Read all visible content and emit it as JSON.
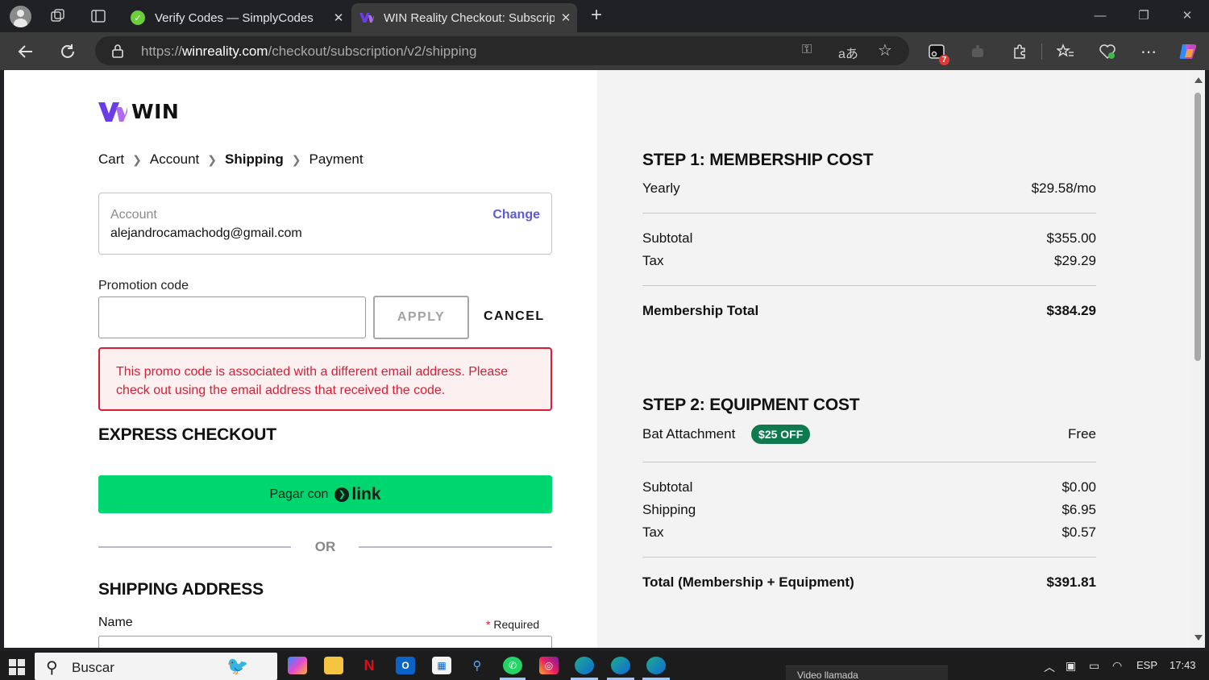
{
  "browser": {
    "tabs": [
      {
        "title": "Verify Codes — SimplyCodes",
        "favicon": "simplycodes-check-icon",
        "active": false
      },
      {
        "title": "WIN Reality Checkout: Subscriptio",
        "favicon": "win-logo-icon",
        "active": true
      }
    ],
    "url": {
      "scheme": "https://",
      "domain": "winreality.com",
      "path": "/checkout/subscription/v2/shipping"
    },
    "extensions_badge": "7"
  },
  "page": {
    "logo_text": "WIN",
    "breadcrumb": {
      "cart": "Cart",
      "account": "Account",
      "shipping": "Shipping",
      "payment": "Payment"
    },
    "account": {
      "label": "Account",
      "email": "alejandrocamachodg@gmail.com",
      "change": "Change"
    },
    "promo": {
      "label": "Promotion code",
      "value": "",
      "apply": "APPLY",
      "cancel": "CANCEL",
      "error": "This promo code is associated with a different email address. Please check out using the email address that received the code."
    },
    "express": {
      "title": "EXPRESS CHECKOUT",
      "pay_prefix": "Pagar con",
      "pay_brand": "link"
    },
    "or": "OR",
    "shipping": {
      "title": "SHIPPING ADDRESS",
      "name_label": "Name",
      "required": "Required",
      "required_star": "*"
    }
  },
  "summary": {
    "step1": {
      "title": "STEP 1: MEMBERSHIP COST",
      "plan": {
        "label": "Yearly",
        "value": "$29.58/mo"
      },
      "subtotal": {
        "label": "Subtotal",
        "value": "$355.00"
      },
      "tax": {
        "label": "Tax",
        "value": "$29.29"
      },
      "total": {
        "label": "Membership Total",
        "value": "$384.29"
      }
    },
    "step2": {
      "title": "STEP 2: EQUIPMENT COST",
      "item": {
        "label": "Bat Attachment",
        "badge": "$25 OFF",
        "value": "Free"
      },
      "subtotal": {
        "label": "Subtotal",
        "value": "$0.00"
      },
      "shipping": {
        "label": "Shipping",
        "value": "$6.95"
      },
      "tax": {
        "label": "Tax",
        "value": "$0.57"
      },
      "total": {
        "label": "Total (Membership + Equipment)",
        "value": "$391.81"
      }
    }
  },
  "taskbar": {
    "search_placeholder": "Buscar",
    "language": "ESP",
    "time": "17:43",
    "toast_text": "Video llamada"
  },
  "colors": {
    "accent_purple": "#6a3de8",
    "link_green": "#00d66f",
    "error_red": "#df1b33",
    "badge_green": "#0e7a4d",
    "change_link": "#5b5bd6"
  }
}
